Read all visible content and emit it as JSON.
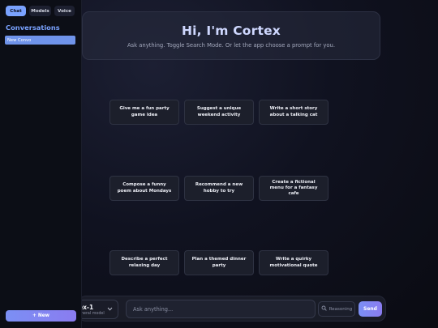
{
  "sidebar": {
    "tabs": [
      {
        "label": "Chat",
        "active": true
      },
      {
        "label": "Models",
        "active": false
      },
      {
        "label": "Voice",
        "active": false
      }
    ],
    "conversations_heading": "Conversations",
    "conversations": [
      "New Convo"
    ],
    "new_button_label": "+ New"
  },
  "hero": {
    "title": "Hi, I'm Cortex",
    "subtitle": "Ask anything. Toggle Search Mode. Or let the app choose a prompt for you."
  },
  "prompts": [
    "Give me a fun party game idea",
    "Suggest a unique weekend activity",
    "Write a short story about a talking cat",
    "Compose a funny poem about Mondays",
    "Recommend a new hobby to try",
    "Create a fictional menu for a fantasy cafe",
    "Describe a perfect relaxing day",
    "Plan a themed dinner party",
    "Write a quirky motivational quote"
  ],
  "composer": {
    "model_name": "ex-1",
    "model_desc": "eneral model",
    "input_placeholder": "Ask anything...",
    "reasoning_label": "Reasoning",
    "send_label": "Send"
  },
  "colors": {
    "accent": "#7aa2ff",
    "button_gradient_start": "#7b8ff4",
    "button_gradient_end": "#8a7cf0"
  }
}
